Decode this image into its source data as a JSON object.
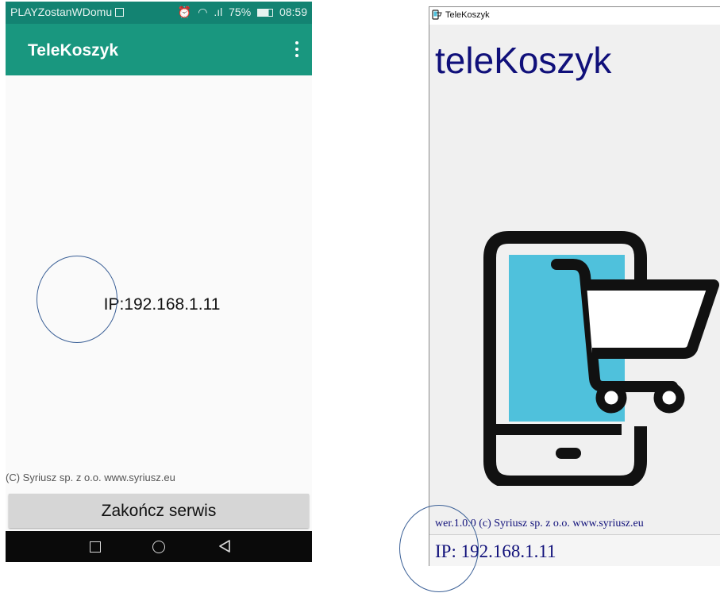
{
  "android": {
    "status_bar": {
      "carrier": "PLAYZostanWDomu",
      "signal_text": ".ıl",
      "battery": "75%",
      "time": "08:59"
    },
    "app_bar": {
      "title": "TeleKoszyk"
    },
    "ip_label": "IP:",
    "ip_value": "192.168.1.11",
    "copyright": "(C) Syriusz sp. z o.o. www.syriusz.eu",
    "end_button": "Zakończ serwis",
    "nav": [
      "square-icon",
      "circle-icon",
      "back-triangle-icon"
    ],
    "colors": {
      "status_bar": "#138372",
      "app_bar": "#19977f"
    }
  },
  "windows": {
    "window_title": "TeleKoszyk",
    "big_title": "teleKoszyk",
    "version_line": "wer.1.0.0  (c) Syriusz sp. z o.o. www.syriusz.eu",
    "ip_line": "IP: 192.168.1.11",
    "hero_icon": "phone-with-shopping-cart-icon",
    "colors": {
      "title_text": "#10107a",
      "screen_fill": "#4fc1dc"
    }
  },
  "annotations": [
    "circle-highlight-left",
    "circle-highlight-right"
  ]
}
